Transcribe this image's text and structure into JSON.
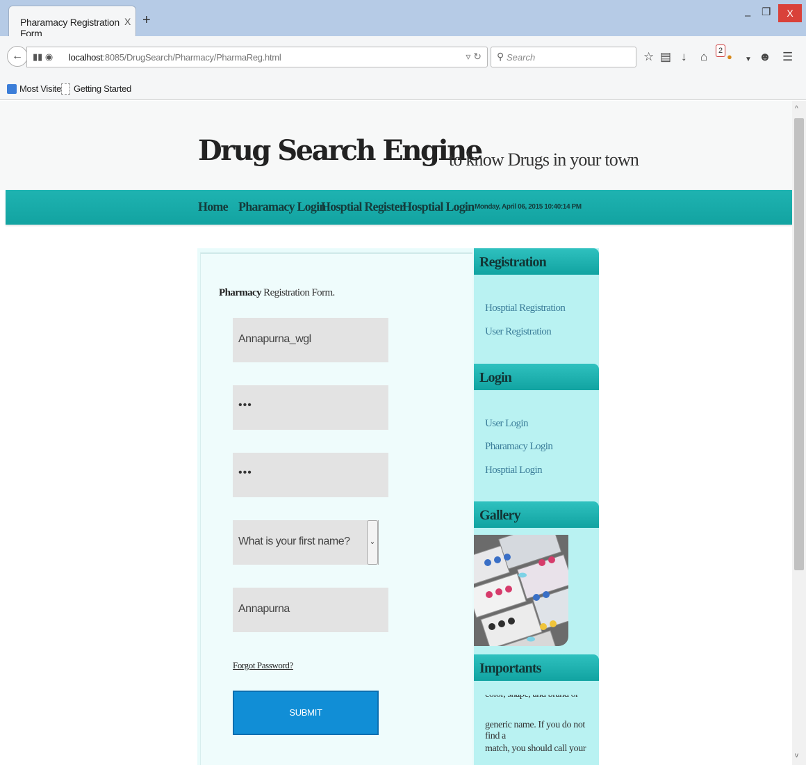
{
  "browser": {
    "tab_title": "Pharamacy Registration Form",
    "tab_close": "X",
    "new_tab": "+",
    "url_host": "localhost",
    "url_path": ":8085/DrugSearch/Pharmacy/PharmaReg.html",
    "search_placeholder": "Search",
    "notification_count": "2",
    "bookmarks": [
      "Most Visited",
      "Getting Started"
    ],
    "close_label": "X"
  },
  "site": {
    "title": "Drug Search Engine",
    "tagline": "to know Drugs in your town"
  },
  "menu": {
    "items": [
      "Home",
      "Pharamacy Login",
      "Hosptial Register",
      "Hosptial Login"
    ],
    "date": "Monday, April 06, 2015 10:40:14 PM"
  },
  "form": {
    "title_bold": "Pharmacy",
    "title_rest": " Registration Form.",
    "username": "Annapurna_wgl",
    "password_mask": "•••",
    "confirm_mask": "•••",
    "security_question": "What is your first name?",
    "answer": "Annapurna",
    "forgot": "Forgot Password?",
    "submit": "SUBMIT"
  },
  "sidebar": {
    "registration_heading": "Registration",
    "registration_links": [
      "Hosptial Registration",
      "User Registration"
    ],
    "login_heading": "Login",
    "login_links": [
      "User Login",
      "Pharamacy Login",
      "Hosptial Login"
    ],
    "gallery_heading": "Gallery",
    "importants_heading": "Importants",
    "importants_lines": [
      "color, shape, and brand or",
      "generic name. If you do not find a",
      "match, you should call your"
    ]
  }
}
